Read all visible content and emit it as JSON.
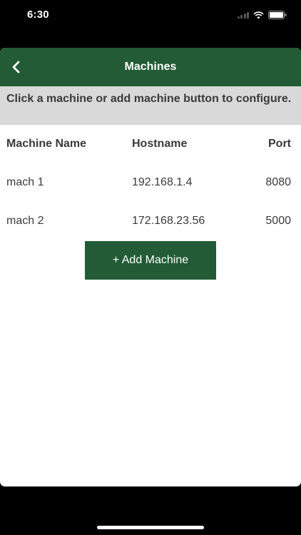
{
  "status_bar": {
    "time": "6:30"
  },
  "nav": {
    "title": "Machines",
    "back_icon": "chevron-left-icon"
  },
  "instructions": "Click a machine or add machine button to configure.",
  "table": {
    "headers": {
      "name": "Machine Name",
      "hostname": "Hostname",
      "port": "Port"
    },
    "rows": [
      {
        "name": "mach 1",
        "hostname": "192.168.1.4",
        "port": "8080"
      },
      {
        "name": "mach 2",
        "hostname": "172.168.23.56",
        "port": "5000"
      }
    ]
  },
  "add_button_label": "+ Add Machine",
  "colors": {
    "accent": "#225b35",
    "instructions_bg": "#d9d9d9",
    "text": "#3a3a3a"
  }
}
